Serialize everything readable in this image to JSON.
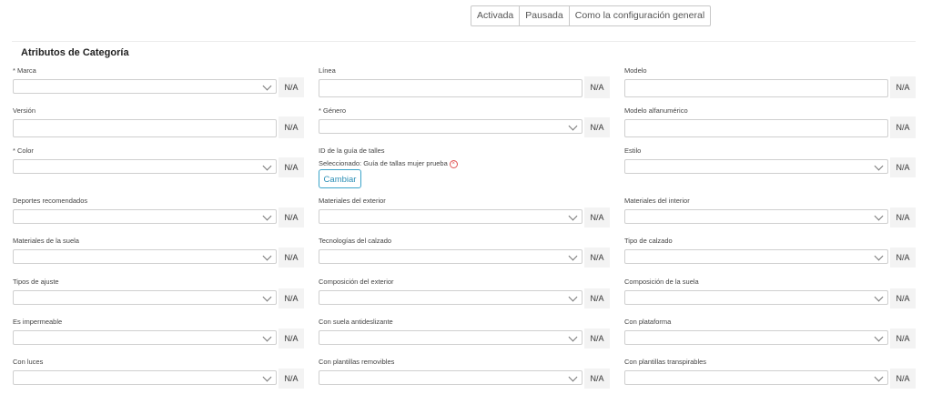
{
  "status_toggle": [
    "Activada",
    "Pausada",
    "Como la configuración general"
  ],
  "section_title": "Atributos de Categoría",
  "na_label": "N/A",
  "fields": {
    "marca": {
      "label": "* Marca",
      "value": ""
    },
    "linea": {
      "label": "Línea",
      "value": ""
    },
    "modelo": {
      "label": "Modelo",
      "value": ""
    },
    "version": {
      "label": "Versión",
      "value": ""
    },
    "genero": {
      "label": "* Género",
      "value": ""
    },
    "modelo_alfanumerico": {
      "label": "Modelo alfanumérico",
      "value": ""
    },
    "color": {
      "label": "* Color",
      "value": ""
    },
    "id_guia_talles": {
      "label": "ID de la guía de talles",
      "selected_text": "Seleccionado: Guía de tallas mujer prueba",
      "change_button": "Cambiar"
    },
    "estilo": {
      "label": "Estilo",
      "value": ""
    },
    "deportes_recomendados": {
      "label": "Deportes recomendados",
      "value": ""
    },
    "materiales_exterior": {
      "label": "Materiales del exterior",
      "value": ""
    },
    "materiales_interior": {
      "label": "Materiales del interior",
      "value": ""
    },
    "materiales_suela": {
      "label": "Materiales de la suela",
      "value": ""
    },
    "tecnologias_calzado": {
      "label": "Tecnologías del calzado",
      "value": ""
    },
    "tipo_calzado": {
      "label": "Tipo de calzado",
      "value": ""
    },
    "tipos_ajuste": {
      "label": "Tipos de ajuste",
      "value": ""
    },
    "composicion_exterior": {
      "label": "Composición del exterior",
      "value": ""
    },
    "composicion_suela": {
      "label": "Composición de la suela",
      "value": ""
    },
    "es_impermeable": {
      "label": "Es impermeable",
      "value": ""
    },
    "suela_antideslizante": {
      "label": "Con suela antideslizante",
      "value": ""
    },
    "con_plataforma": {
      "label": "Con plataforma",
      "value": ""
    },
    "con_luces": {
      "label": "Con luces",
      "value": ""
    },
    "plantillas_removibles": {
      "label": "Con plantillas removibles",
      "value": ""
    },
    "plantillas_transpirables": {
      "label": "Con plantillas transpirables",
      "value": ""
    }
  }
}
